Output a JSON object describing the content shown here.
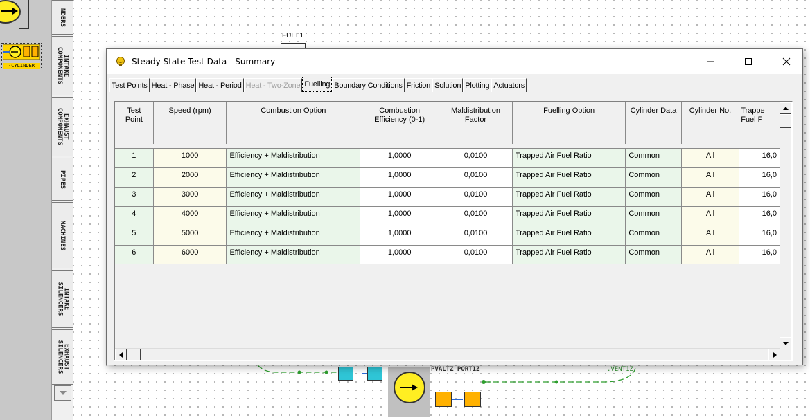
{
  "palette": {
    "tabs": [
      {
        "label": "NDERS"
      },
      {
        "label": "INTAKE\nCOMPONENTS"
      },
      {
        "label": "EXHAUST\nCOMPONENTS"
      },
      {
        "label": "PIPES"
      },
      {
        "label": "MACHINES"
      },
      {
        "label": "INTAKE\nSILENCERS"
      },
      {
        "label": "EXHAUST\nSILENCERS"
      }
    ],
    "selected_item_label": "-CYLINDER"
  },
  "canvas": {
    "fuel_label": "FUEL1",
    "port_label": "PVALTZ PORT1Z",
    "vent_label": ".VENT1Z"
  },
  "dialog": {
    "title": "Steady State Test Data - Summary",
    "tabs": [
      {
        "label": "Test Points",
        "state": "normal"
      },
      {
        "label": "Heat - Phase",
        "state": "normal"
      },
      {
        "label": "Heat - Period",
        "state": "normal"
      },
      {
        "label": "Heat - Two-Zone",
        "state": "disabled"
      },
      {
        "label": "Fuelling",
        "state": "active"
      },
      {
        "label": "Boundary Conditions",
        "state": "normal"
      },
      {
        "label": "Friction",
        "state": "normal"
      },
      {
        "label": "Solution",
        "state": "normal"
      },
      {
        "label": "Plotting",
        "state": "normal"
      },
      {
        "label": "Actuators",
        "state": "normal"
      }
    ],
    "table": {
      "headers": {
        "test_point_1": "Test",
        "test_point_2": "Point",
        "speed": "Speed (rpm)",
        "combustion_option": "Combustion Option",
        "combustion_eff_1": "Combustion",
        "combustion_eff_2": "Efficiency (0-1)",
        "maldist_1": "Maldistribution",
        "maldist_2": "Factor",
        "fuelling_option": "Fuelling Option",
        "cylinder_data": "Cylinder Data",
        "cylinder_no": "Cylinder No.",
        "trapped_1": "Trappe",
        "trapped_2": "Fuel F"
      },
      "rows": [
        {
          "point": "1",
          "speed": "1000",
          "combustion": "Efficiency + Maldistribution",
          "efficiency": "1,0000",
          "maldist": "0,0100",
          "fuelling": "Trapped Air Fuel Ratio",
          "cyl_data": "Common",
          "cyl_no": "All",
          "afr": "16,0"
        },
        {
          "point": "2",
          "speed": "2000",
          "combustion": "Efficiency + Maldistribution",
          "efficiency": "1,0000",
          "maldist": "0,0100",
          "fuelling": "Trapped Air Fuel Ratio",
          "cyl_data": "Common",
          "cyl_no": "All",
          "afr": "16,0"
        },
        {
          "point": "3",
          "speed": "3000",
          "combustion": "Efficiency + Maldistribution",
          "efficiency": "1,0000",
          "maldist": "0,0100",
          "fuelling": "Trapped Air Fuel Ratio",
          "cyl_data": "Common",
          "cyl_no": "All",
          "afr": "16,0"
        },
        {
          "point": "4",
          "speed": "4000",
          "combustion": "Efficiency + Maldistribution",
          "efficiency": "1,0000",
          "maldist": "0,0100",
          "fuelling": "Trapped Air Fuel Ratio",
          "cyl_data": "Common",
          "cyl_no": "All",
          "afr": "16,0"
        },
        {
          "point": "5",
          "speed": "5000",
          "combustion": "Efficiency + Maldistribution",
          "efficiency": "1,0000",
          "maldist": "0,0100",
          "fuelling": "Trapped Air Fuel Ratio",
          "cyl_data": "Common",
          "cyl_no": "All",
          "afr": "16,0"
        },
        {
          "point": "6",
          "speed": "6000",
          "combustion": "Efficiency + Maldistribution",
          "efficiency": "1,0000",
          "maldist": "0,0100",
          "fuelling": "Trapped Air Fuel Ratio",
          "cyl_data": "Common",
          "cyl_no": "All",
          "afr": "16,0"
        }
      ]
    }
  },
  "colors": {
    "engine_yellow": "#ffee22",
    "component_cyan": "#2fc5d6",
    "component_orange": "#ffb100",
    "pipe_green": "#2e9e2e",
    "grid_green_cell": "#eaf6ea",
    "grid_yellow_cell": "#fcfbea"
  }
}
